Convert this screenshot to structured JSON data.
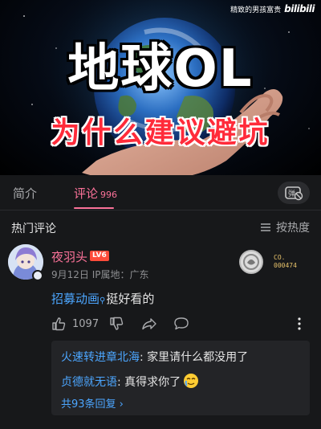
{
  "video": {
    "watermark_text": "精致的男孩富贵",
    "watermark_logo": "bilibili",
    "title": "地球OL",
    "subtitle": "为什么建议避坑"
  },
  "tabs": {
    "intro": "简介",
    "comments": "评论",
    "comments_count": "996"
  },
  "hot": {
    "title": "热门评论",
    "sort_label": "按热度"
  },
  "comment": {
    "username": "夜羽头",
    "level": "LV6",
    "meta": "9月12日 IP属地：广东",
    "fan_badge_code": "CO.",
    "fan_badge_number": "000474",
    "link_text": "招募动画",
    "text": "挺好看的",
    "likes": "1097"
  },
  "replies": {
    "items": [
      {
        "author": "火速转进章北海",
        "text": ": 家里请什么都没用了"
      },
      {
        "author": "贞德就无语",
        "text": ": 真得求你了"
      }
    ],
    "total_label": "共93条回复 ›"
  },
  "colors": {
    "accent_pink": "#fb7299",
    "link_blue": "#4ca6ff",
    "background": "#17181a"
  }
}
